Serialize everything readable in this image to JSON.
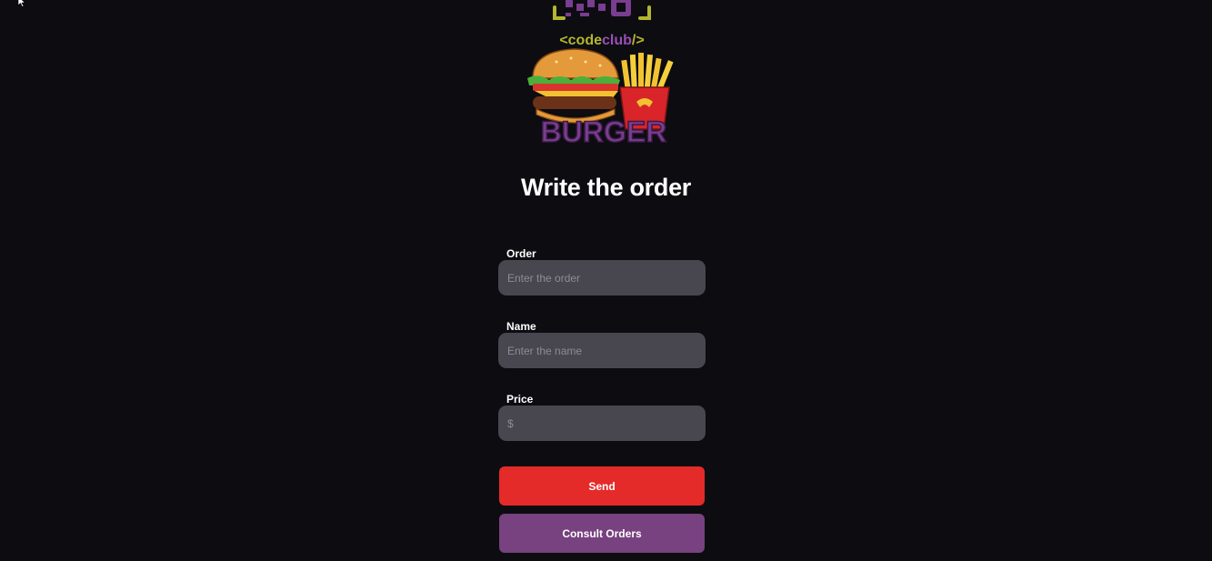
{
  "header": {
    "logo_text": "<codeclub/>",
    "logo_word": "BURGER",
    "logo_icon": "burger-fries-logo"
  },
  "page": {
    "title": "Write the order"
  },
  "form": {
    "order": {
      "label": "Order",
      "placeholder": "Enter the order",
      "value": ""
    },
    "name": {
      "label": "Name",
      "placeholder": "Enter the name",
      "value": ""
    },
    "price": {
      "label": "Price",
      "placeholder": "$",
      "value": ""
    }
  },
  "actions": {
    "send_label": "Send",
    "consult_label": "Consult Orders"
  },
  "colors": {
    "background": "#0c0c11",
    "input_bg": "#48464e",
    "send": "#e52a2a",
    "consult": "#77427f",
    "logo_green": "#b3b62e",
    "logo_purple": "#7a3d8f"
  }
}
